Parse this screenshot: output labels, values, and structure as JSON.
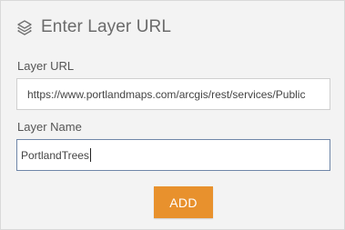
{
  "header": {
    "icon": "layers-icon",
    "title": "Enter Layer URL"
  },
  "form": {
    "url_label": "Layer URL",
    "url_value": "https://www.portlandmaps.com/arcgis/rest/services/Public",
    "name_label": "Layer Name",
    "name_value": "PortlandTrees"
  },
  "actions": {
    "add_label": "ADD",
    "add_color": "#e8912d"
  }
}
